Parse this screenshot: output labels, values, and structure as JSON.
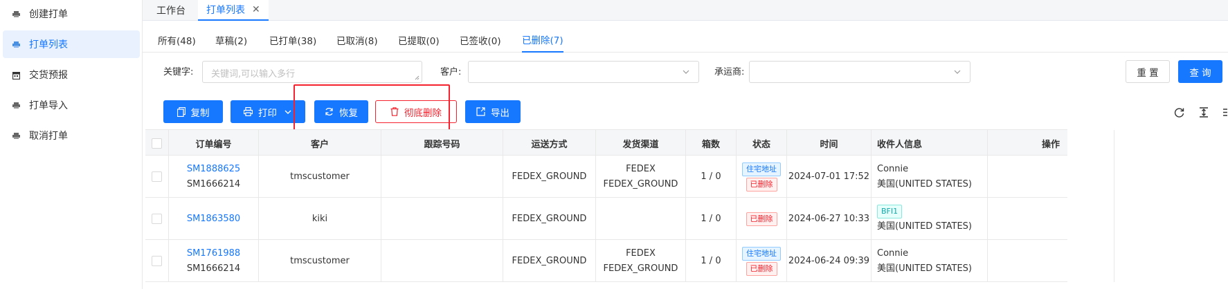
{
  "sidebar": {
    "items": [
      {
        "label": "创建打单",
        "icon": "printer-icon",
        "active": false
      },
      {
        "label": "打单列表",
        "icon": "printer-icon",
        "active": true
      },
      {
        "label": "交货预报",
        "icon": "calendar-icon",
        "active": false
      },
      {
        "label": "打单导入",
        "icon": "printer-icon",
        "active": false
      },
      {
        "label": "取消打单",
        "icon": "printer-icon",
        "active": false
      }
    ]
  },
  "page_tabs": [
    {
      "label": "工作台"
    },
    {
      "label": "打单列表",
      "close": "✕"
    }
  ],
  "status_tabs": [
    "所有(48)",
    "草稿(2)",
    "已打单(38)",
    "已取消(8)",
    "已提取(0)",
    "已签收(0)",
    "已删除(7)"
  ],
  "filters": {
    "keyword_label": "关键字:",
    "keyword_placeholder": "关键词,可以输入多行",
    "customer_label": "客户:",
    "carrier_label": "承运商:"
  },
  "buttons": {
    "reset": "重 置",
    "search": "查 询",
    "copy": "复制",
    "print": "打印",
    "restore": "恢复",
    "purge": "彻底删除",
    "export": "导出"
  },
  "colors": {
    "primary": "#1677ff",
    "danger": "#f5222d",
    "highlight_box": "#f5222d"
  },
  "table": {
    "columns": [
      "订单编号",
      "客户",
      "跟踪号码",
      "运送方式",
      "发货渠道",
      "箱数",
      "状态",
      "时间",
      "收件人信息",
      "操作"
    ],
    "rows": [
      {
        "order_no": "SM1888625",
        "order_sub": "SM1666214",
        "customer": "tmscustomer",
        "tracking": "",
        "shipping": "FEDEX_GROUND",
        "channel_1": "FEDEX",
        "channel_2": "FEDEX_GROUND",
        "boxes": "1 / 0",
        "tag_1": "住宅地址",
        "tag_2": "已删除",
        "time": "2024-07-01 17:52",
        "recipient_1": "Connie",
        "recipient_2": "美国(UNITED STATES)"
      },
      {
        "order_no": "SM1863580",
        "order_sub": "",
        "customer": "kiki",
        "tracking": "",
        "shipping": "FEDEX_GROUND",
        "channel_1": "",
        "channel_2": "",
        "boxes": "1 / 0",
        "tag_1": "已删除",
        "tag_2": "",
        "time": "2024-06-27 10:33",
        "recipient_tag": "BFI1",
        "recipient_2": "美国(UNITED STATES)"
      },
      {
        "order_no": "SM1761988",
        "order_sub": "SM1666214",
        "customer": "tmscustomer",
        "tracking": "",
        "shipping": "FEDEX_GROUND",
        "channel_1": "FEDEX",
        "channel_2": "FEDEX_GROUND",
        "boxes": "1 / 0",
        "tag_1": "住宅地址",
        "tag_2": "已删除",
        "time": "2024-06-24 09:39",
        "recipient_1": "Connie",
        "recipient_2": "美国(UNITED STATES)"
      }
    ]
  }
}
